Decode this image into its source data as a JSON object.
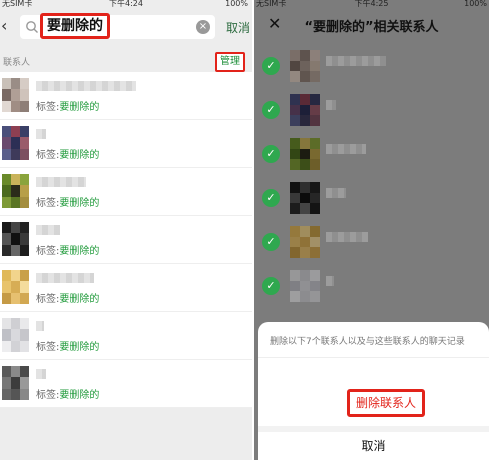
{
  "left": {
    "status": {
      "carrier": "无SIM卡",
      "time": "下午4:24",
      "battery": "100%"
    },
    "search": {
      "query": "要删除的",
      "cancel": "取消"
    },
    "section": {
      "title": "联系人",
      "manage": "管理"
    },
    "tag_prefix": "标签:",
    "contacts": [
      {
        "tag": "要删除的"
      },
      {
        "tag": "要删除的"
      },
      {
        "tag": "要删除的"
      },
      {
        "tag": "要删除的"
      },
      {
        "tag": "要删除的"
      },
      {
        "tag": "要删除的"
      },
      {
        "tag": "要删除的"
      }
    ]
  },
  "right": {
    "status": {
      "carrier": "无SIM卡",
      "time": "下午4:25",
      "battery": "100%"
    },
    "title": "“要删除的”相关联系人",
    "sheet": {
      "message": "删除以下7个联系人以及与这些联系人的聊天记录",
      "delete": "删除联系人",
      "cancel": "取消"
    }
  },
  "colors": {
    "accent_green": "#1f9a3a",
    "highlight_red": "#e2231a",
    "check_green": "#2fa84f"
  }
}
